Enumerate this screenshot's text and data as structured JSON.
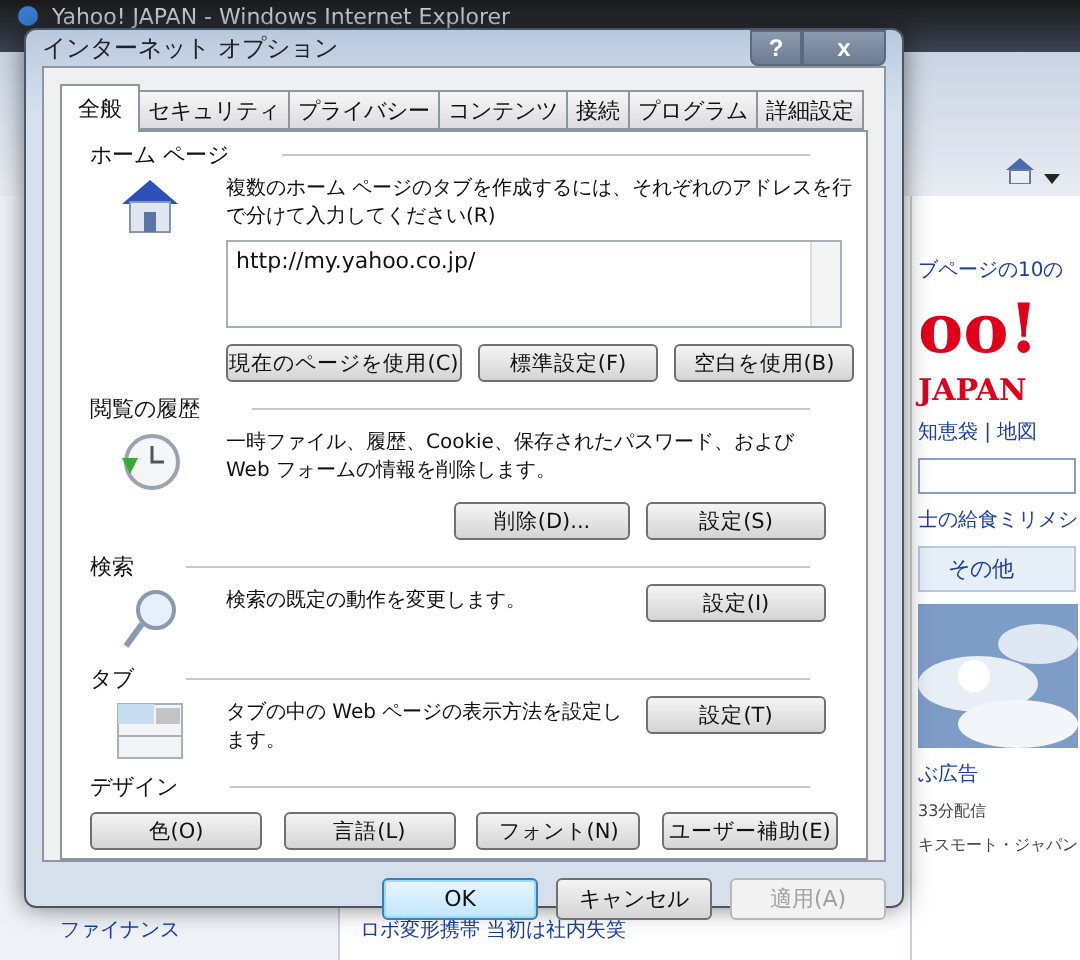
{
  "browser": {
    "title": "Yahoo! JAPAN - Windows Internet Explorer",
    "side_texts": [
      {
        "kind": "link",
        "text": "ブページの10の"
      },
      {
        "kind": "logo",
        "text": "oo!"
      },
      {
        "kind": "logo-sub",
        "text": "JAPAN"
      },
      {
        "kind": "links",
        "text": "知恵袋 | 地図"
      },
      {
        "kind": "search"
      },
      {
        "kind": "link",
        "text": "士の給食ミリメシ"
      },
      {
        "kind": "tab",
        "text": "その他"
      },
      {
        "kind": "picture"
      },
      {
        "kind": "link",
        "text": "ぶ広告"
      },
      {
        "kind": "small",
        "text": "33分配信"
      },
      {
        "kind": "small",
        "text": "キスモート・ジャパン"
      }
    ],
    "left_links": [
      "ファイナンス"
    ],
    "news": "ロボ変形携帯 当初は社内失笑"
  },
  "dialog": {
    "title": "インターネット オプション",
    "help": "?",
    "close": "x",
    "tabs": [
      {
        "label": "全般",
        "selected": true
      },
      {
        "label": "セキュリティ",
        "selected": false
      },
      {
        "label": "プライバシー",
        "selected": false
      },
      {
        "label": "コンテンツ",
        "selected": false
      },
      {
        "label": "接続",
        "selected": false
      },
      {
        "label": "プログラム",
        "selected": false
      },
      {
        "label": "詳細設定",
        "selected": false
      }
    ],
    "sections": [
      {
        "kind": "homepage",
        "heading": "ホーム ページ",
        "description": "複数のホーム ページのタブを作成するには、それぞれのアドレスを行で分けて入力してください(R)",
        "address": "http://my.yahoo.co.jp/",
        "buttons": [
          "現在のページを使用(C)",
          "標準設定(F)",
          "空白を使用(B)"
        ]
      },
      {
        "kind": "history",
        "heading": "閲覧の履歴",
        "description": "一時ファイル、履歴、Cookie、保存されたパスワード、および Web フォームの情報を削除します。",
        "buttons": [
          "削除(D)...",
          "設定(S)"
        ]
      },
      {
        "kind": "search",
        "heading": "検索",
        "description": "検索の既定の動作を変更します。",
        "buttons": [
          "設定(I)"
        ]
      },
      {
        "kind": "tabs",
        "heading": "タブ",
        "description": "タブの中の Web ページの表示方法を設定します。",
        "buttons": [
          "設定(T)"
        ]
      },
      {
        "kind": "design",
        "heading": "デザイン",
        "buttons": [
          "色(O)",
          "言語(L)",
          "フォント(N)",
          "ユーザー補助(E)"
        ]
      }
    ],
    "footer_buttons": [
      {
        "label": "OK",
        "default": true,
        "disabled": false
      },
      {
        "label": "キャンセル",
        "default": false,
        "disabled": false
      },
      {
        "label": "適用(A)",
        "default": false,
        "disabled": true
      }
    ]
  }
}
